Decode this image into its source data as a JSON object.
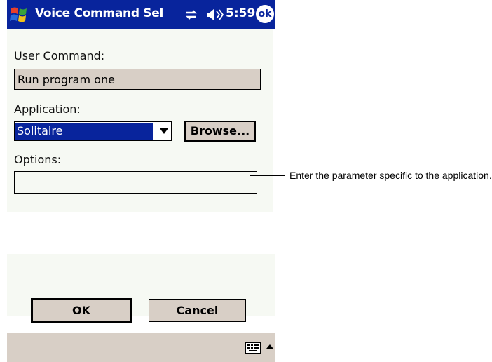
{
  "titlebar": {
    "title": "Voice Command Sel",
    "time": "5:59",
    "ok_label": "ok"
  },
  "form": {
    "user_command_label": "User Command:",
    "user_command_value": "Run program one",
    "application_label": "Application:",
    "application_selected": "Solitaire",
    "browse_label": "Browse...",
    "options_label": "Options:",
    "options_value": ""
  },
  "callout": {
    "text": "Enter the parameter specific to the application."
  },
  "buttons": {
    "ok_label": "OK",
    "cancel_label": "Cancel"
  },
  "icons": {
    "start": "windows-flag-icon",
    "connectivity": "connectivity-icon",
    "volume": "volume-icon",
    "keyboard": "keyboard-icon",
    "sip": "sip-arrow-up-icon"
  },
  "colors": {
    "titlebar": "#08249c",
    "selection": "#08249c",
    "button_face": "#d8cfc6",
    "panel": "#f6f9f3"
  }
}
